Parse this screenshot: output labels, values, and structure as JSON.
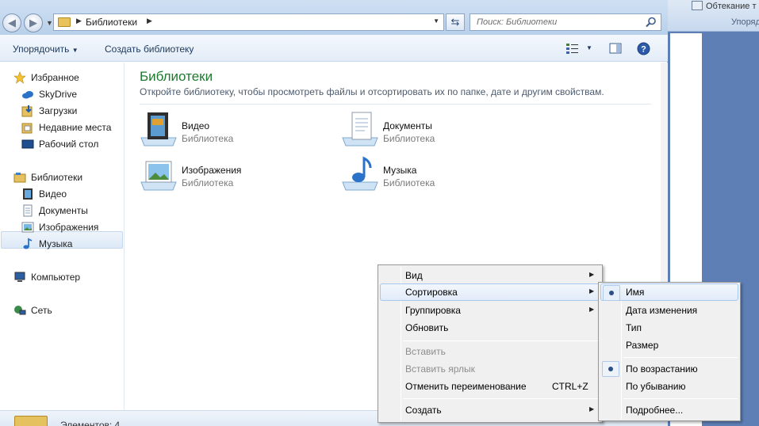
{
  "background_app": {
    "title_fragment": "Обтекание т",
    "ribbon_fragment": "Упоряд"
  },
  "explorer": {
    "address": {
      "crumb": "Библиотеки"
    },
    "search": {
      "placeholder": "Поиск: Библиотеки"
    },
    "toolbar": {
      "organize": "Упорядочить",
      "new_library": "Создать библиотеку"
    },
    "nav": {
      "favorites": "Избранное",
      "favorites_items": [
        "SkyDrive",
        "Загрузки",
        "Недавние места",
        "Рабочий стол"
      ],
      "libraries": "Библиотеки",
      "libraries_items": [
        "Видео",
        "Документы",
        "Изображения",
        "Музыка"
      ],
      "computer": "Компьютер",
      "network": "Сеть"
    },
    "content": {
      "title": "Библиотеки",
      "subtitle": "Откройте библиотеку, чтобы просмотреть файлы и отсортировать их по папке, дате и другим свойствам.",
      "libraries": [
        {
          "name": "Видео",
          "type": "Библиотека",
          "icon": "video-library-icon"
        },
        {
          "name": "Документы",
          "type": "Библиотека",
          "icon": "documents-library-icon"
        },
        {
          "name": "Изображения",
          "type": "Библиотека",
          "icon": "pictures-library-icon"
        },
        {
          "name": "Музыка",
          "type": "Библиотека",
          "icon": "music-library-icon"
        }
      ]
    },
    "status": {
      "items": "Элементов: 4"
    }
  },
  "context_menu": {
    "view": "Вид",
    "sort": "Сортировка",
    "group": "Группировка",
    "refresh": "Обновить",
    "paste": "Вставить",
    "paste_shortcut": "Вставить ярлык",
    "undo_rename": "Отменить переименование",
    "undo_shortcut": "CTRL+Z",
    "create": "Создать"
  },
  "sort_submenu": {
    "name": "Имя",
    "date_modified": "Дата изменения",
    "type": "Тип",
    "size": "Размер",
    "ascending": "По возрастанию",
    "descending": "По убыванию",
    "more": "Подробнее...",
    "selected_field": "Имя",
    "selected_order": "По возрастанию"
  },
  "colors": {
    "title_green": "#1e7a2e",
    "highlight_border": "#a8c7ec",
    "link_blue": "#1e395b"
  }
}
